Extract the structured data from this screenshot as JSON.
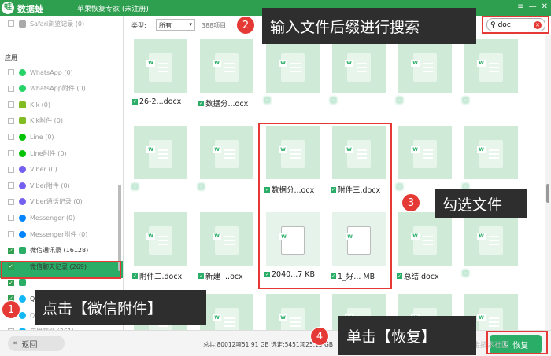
{
  "titlebar": {
    "logo_glyph": "蛙",
    "brand": "数据蛙",
    "title": "苹果恢复专家 (未注册)",
    "buttons": [
      "≡",
      "—",
      "✕"
    ]
  },
  "sidebar": {
    "top_item": "Safari浏览记录 (0)",
    "section": "应用",
    "items": [
      {
        "label": "WhatsApp (0)",
        "icon": "wa"
      },
      {
        "label": "WhatsApp附件 (0)",
        "icon": "wa"
      },
      {
        "label": "Kik (0)",
        "icon": "kik"
      },
      {
        "label": "Kik附件 (0)",
        "icon": "kik"
      },
      {
        "label": "Line (0)",
        "icon": "line"
      },
      {
        "label": "Line附件 (0)",
        "icon": "line"
      },
      {
        "label": "Viber (0)",
        "icon": "viber"
      },
      {
        "label": "Viber附件 (0)",
        "icon": "viber"
      },
      {
        "label": "Viber通话记录 (0)",
        "icon": "viber"
      },
      {
        "label": "Messenger (0)",
        "icon": "msg"
      },
      {
        "label": "Messenger附件 (0)",
        "icon": "msg"
      },
      {
        "label": "微信通讯录 (16128)",
        "icon": "wx"
      },
      {
        "label": "微信聊天记录 (269)",
        "icon": "wx"
      },
      {
        "label": "微信附件 (25628)",
        "icon": "wx"
      },
      {
        "label": "QQ (37)",
        "icon": "qq"
      },
      {
        "label": "QQ附件 (0)",
        "icon": "qq"
      },
      {
        "label": "应用文档 (361)",
        "icon": "qq"
      }
    ]
  },
  "toolbar": {
    "type_label": "类型:",
    "type_value": "所有",
    "count": "388项目",
    "search_value": "doc"
  },
  "files": [
    [
      "26-2...docx",
      "数据分...ocx",
      "",
      "",
      "",
      ""
    ],
    [
      "",
      "",
      "数据分...ocx",
      "附件三.docx",
      "",
      ""
    ],
    [
      "附件二.docx",
      "新建 ...ocx",
      "2040...7 KB",
      "1_好... MB",
      "总结.docx",
      ""
    ]
  ],
  "footer": {
    "back": "返回",
    "status": "总共:80012项51.91 GB 选定:5451项25.15 GB",
    "recover": "恢复"
  },
  "annotations": [
    {
      "num": "1",
      "text": "点击【微信附件】"
    },
    {
      "num": "2",
      "text": "输入文件后缀进行搜索"
    },
    {
      "num": "3",
      "text": "勾选文件"
    },
    {
      "num": "4",
      "text": "单击【恢复】"
    }
  ],
  "watermark": "@稀土掘金技术社区",
  "colors": {
    "accent": "#2aae67",
    "titlebar": "#2e9e4f",
    "highlight": "#e53935"
  }
}
